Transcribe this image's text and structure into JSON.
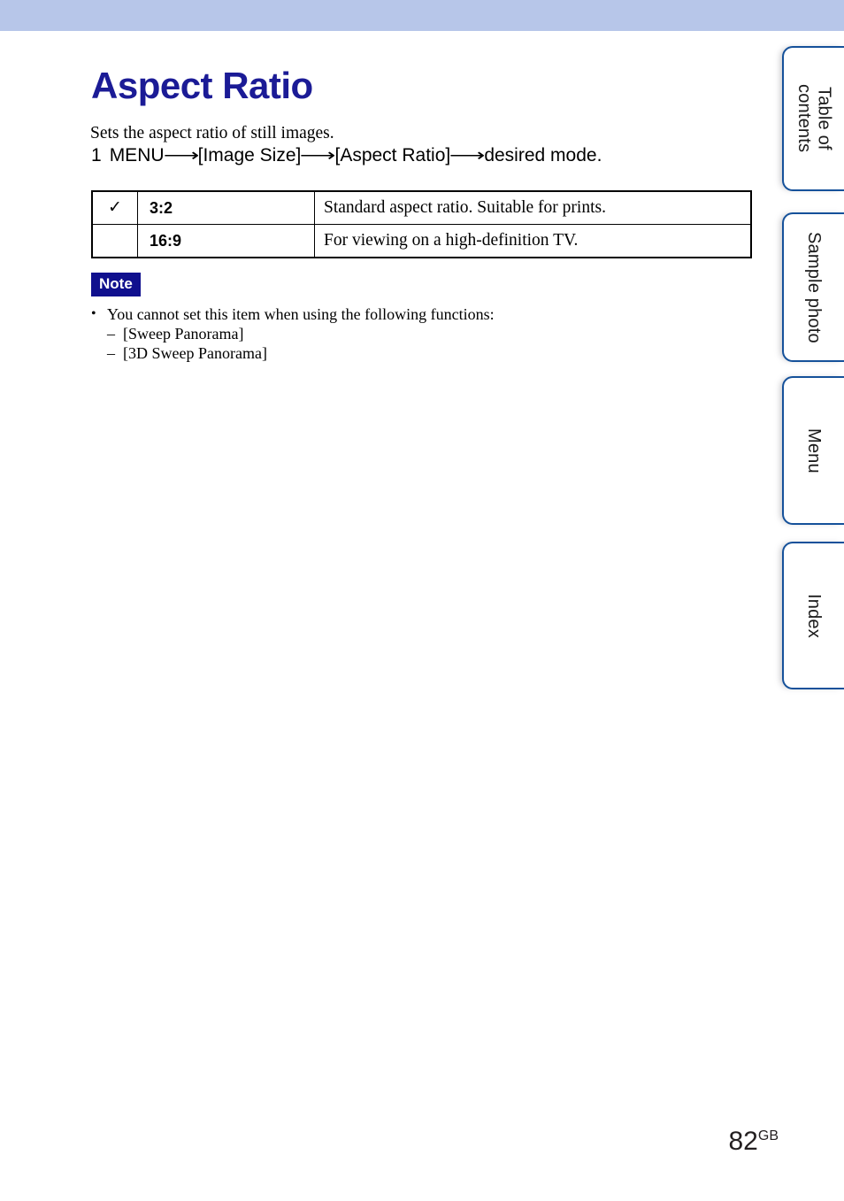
{
  "header": {
    "band_color": "#b7c6e9"
  },
  "page": {
    "title": "Aspect Ratio",
    "title_color": "#1b1b96",
    "intro": "Sets the aspect ratio of still images.",
    "number": "82",
    "number_suffix": "GB"
  },
  "step": {
    "number": "1",
    "part1": "MENU",
    "arrow1": "⟶",
    "part2": "[Image Size]",
    "arrow2": "⟶",
    "part3": "[Aspect Ratio]",
    "arrow3": "⟶",
    "part4": "desired mode."
  },
  "options_table": {
    "rows": [
      {
        "check": "✓",
        "selected": true,
        "label": "3:2",
        "description": "Standard aspect ratio. Suitable for prints."
      },
      {
        "check": "",
        "selected": false,
        "label": "16:9",
        "description": "For viewing on a high-definition TV."
      }
    ]
  },
  "note": {
    "badge_label": "Note",
    "badge_bg": "#10108e",
    "bullet": "•",
    "dash": "–",
    "items": [
      "You cannot set this item when using the following functions:"
    ],
    "sub_items": [
      "[Sweep Panorama]",
      "[3D Sweep Panorama]"
    ]
  },
  "side_tabs": {
    "border_color": "#15519a",
    "items": [
      {
        "label": "Table of\ncontents"
      },
      {
        "label": "Sample photo"
      },
      {
        "label": "Menu"
      },
      {
        "label": "Index"
      }
    ]
  }
}
